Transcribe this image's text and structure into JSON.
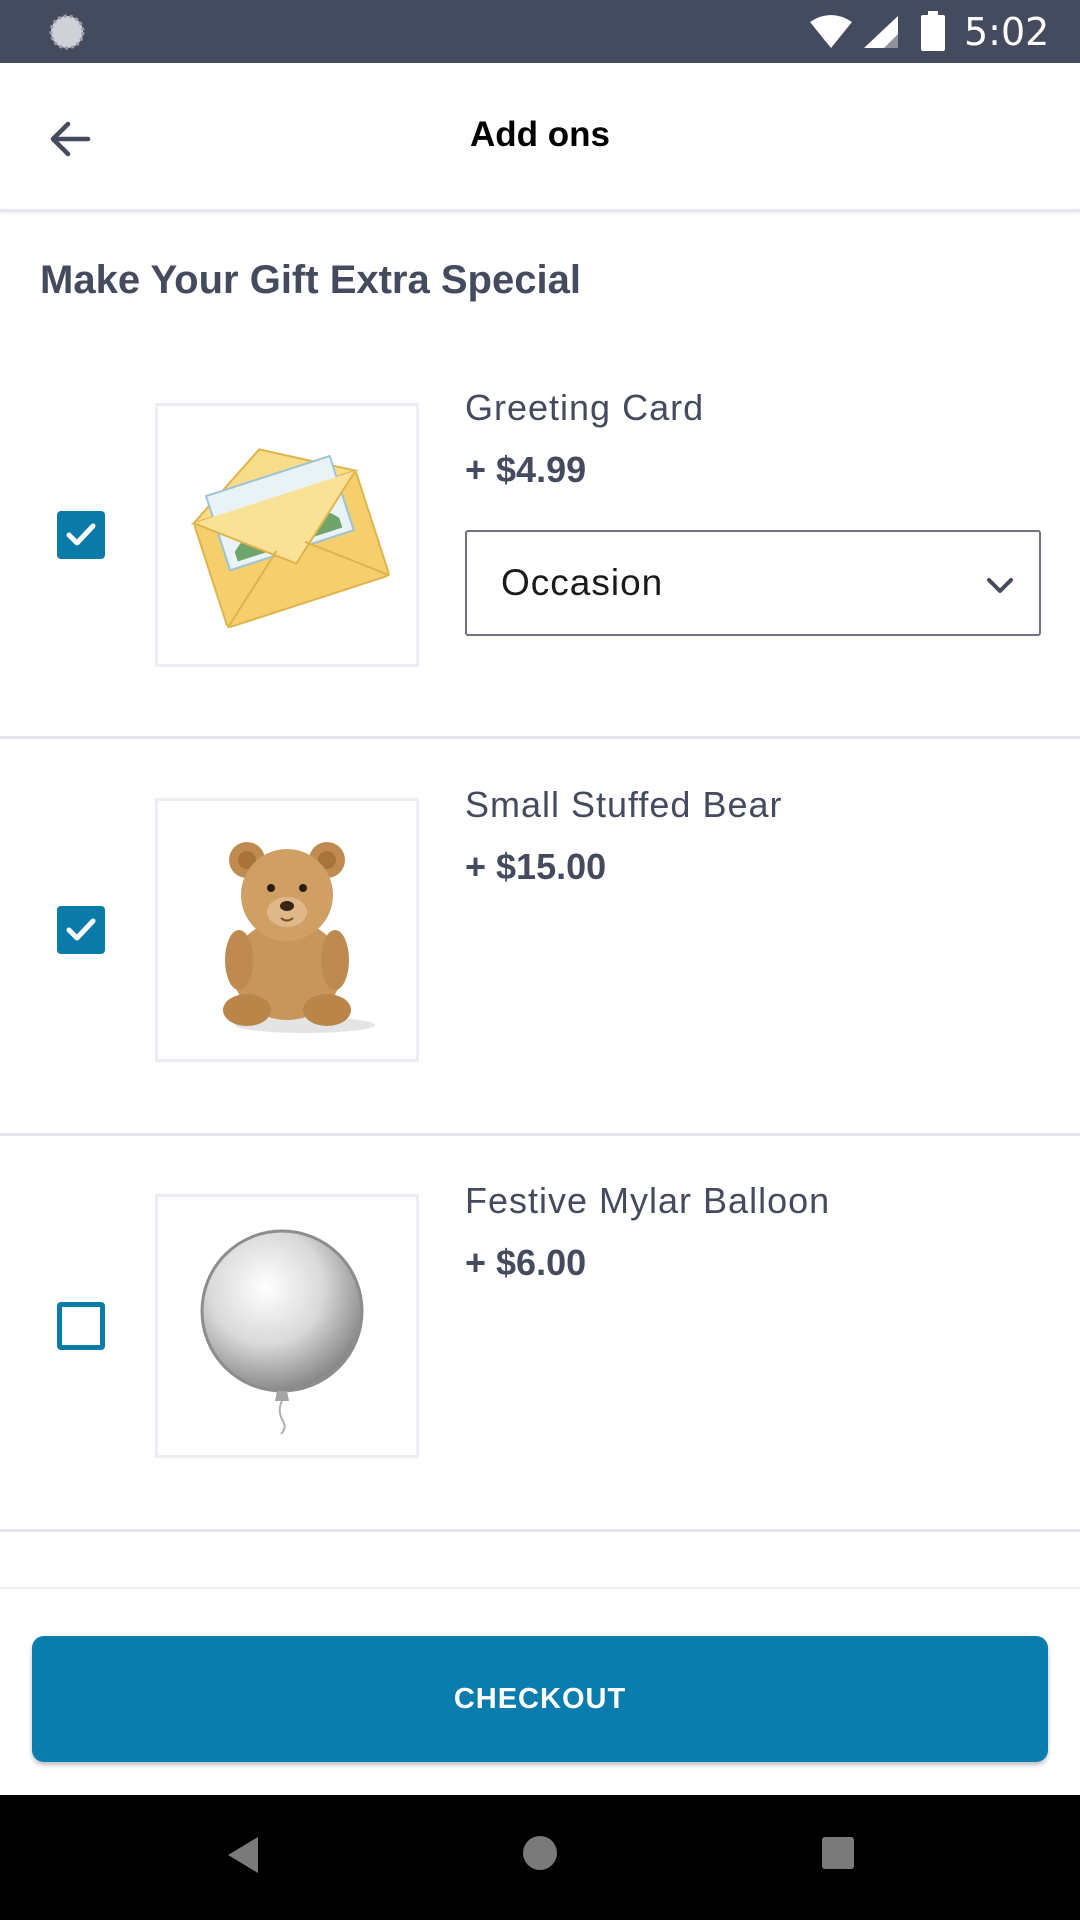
{
  "status_bar": {
    "time": "5:02",
    "icons": [
      "loading-icon",
      "wifi-icon",
      "signal-icon",
      "battery-icon"
    ]
  },
  "app_bar": {
    "title": "Add ons",
    "back_icon": "arrow-left-icon"
  },
  "section": {
    "heading": "Make Your Gift Extra Special"
  },
  "addons": [
    {
      "name": "Greeting Card",
      "price": "+ $4.99",
      "checked": true,
      "image": "greeting-card-envelope",
      "select": {
        "value": "Occasion",
        "icon": "chevron-down-icon"
      }
    },
    {
      "name": "Small Stuffed Bear",
      "price": "+ $15.00",
      "checked": true,
      "image": "teddy-bear"
    },
    {
      "name": "Festive Mylar Balloon",
      "price": "+ $6.00",
      "checked": false,
      "image": "silver-mylar-balloon"
    }
  ],
  "footer": {
    "checkout_label": "CHECKOUT"
  },
  "colors": {
    "status_bar": "#454b5e",
    "accent": "#0a7cad",
    "text": "#454b5e"
  },
  "nav_bar": {
    "icons": [
      "nav-back-icon",
      "nav-home-icon",
      "nav-recents-icon"
    ]
  }
}
